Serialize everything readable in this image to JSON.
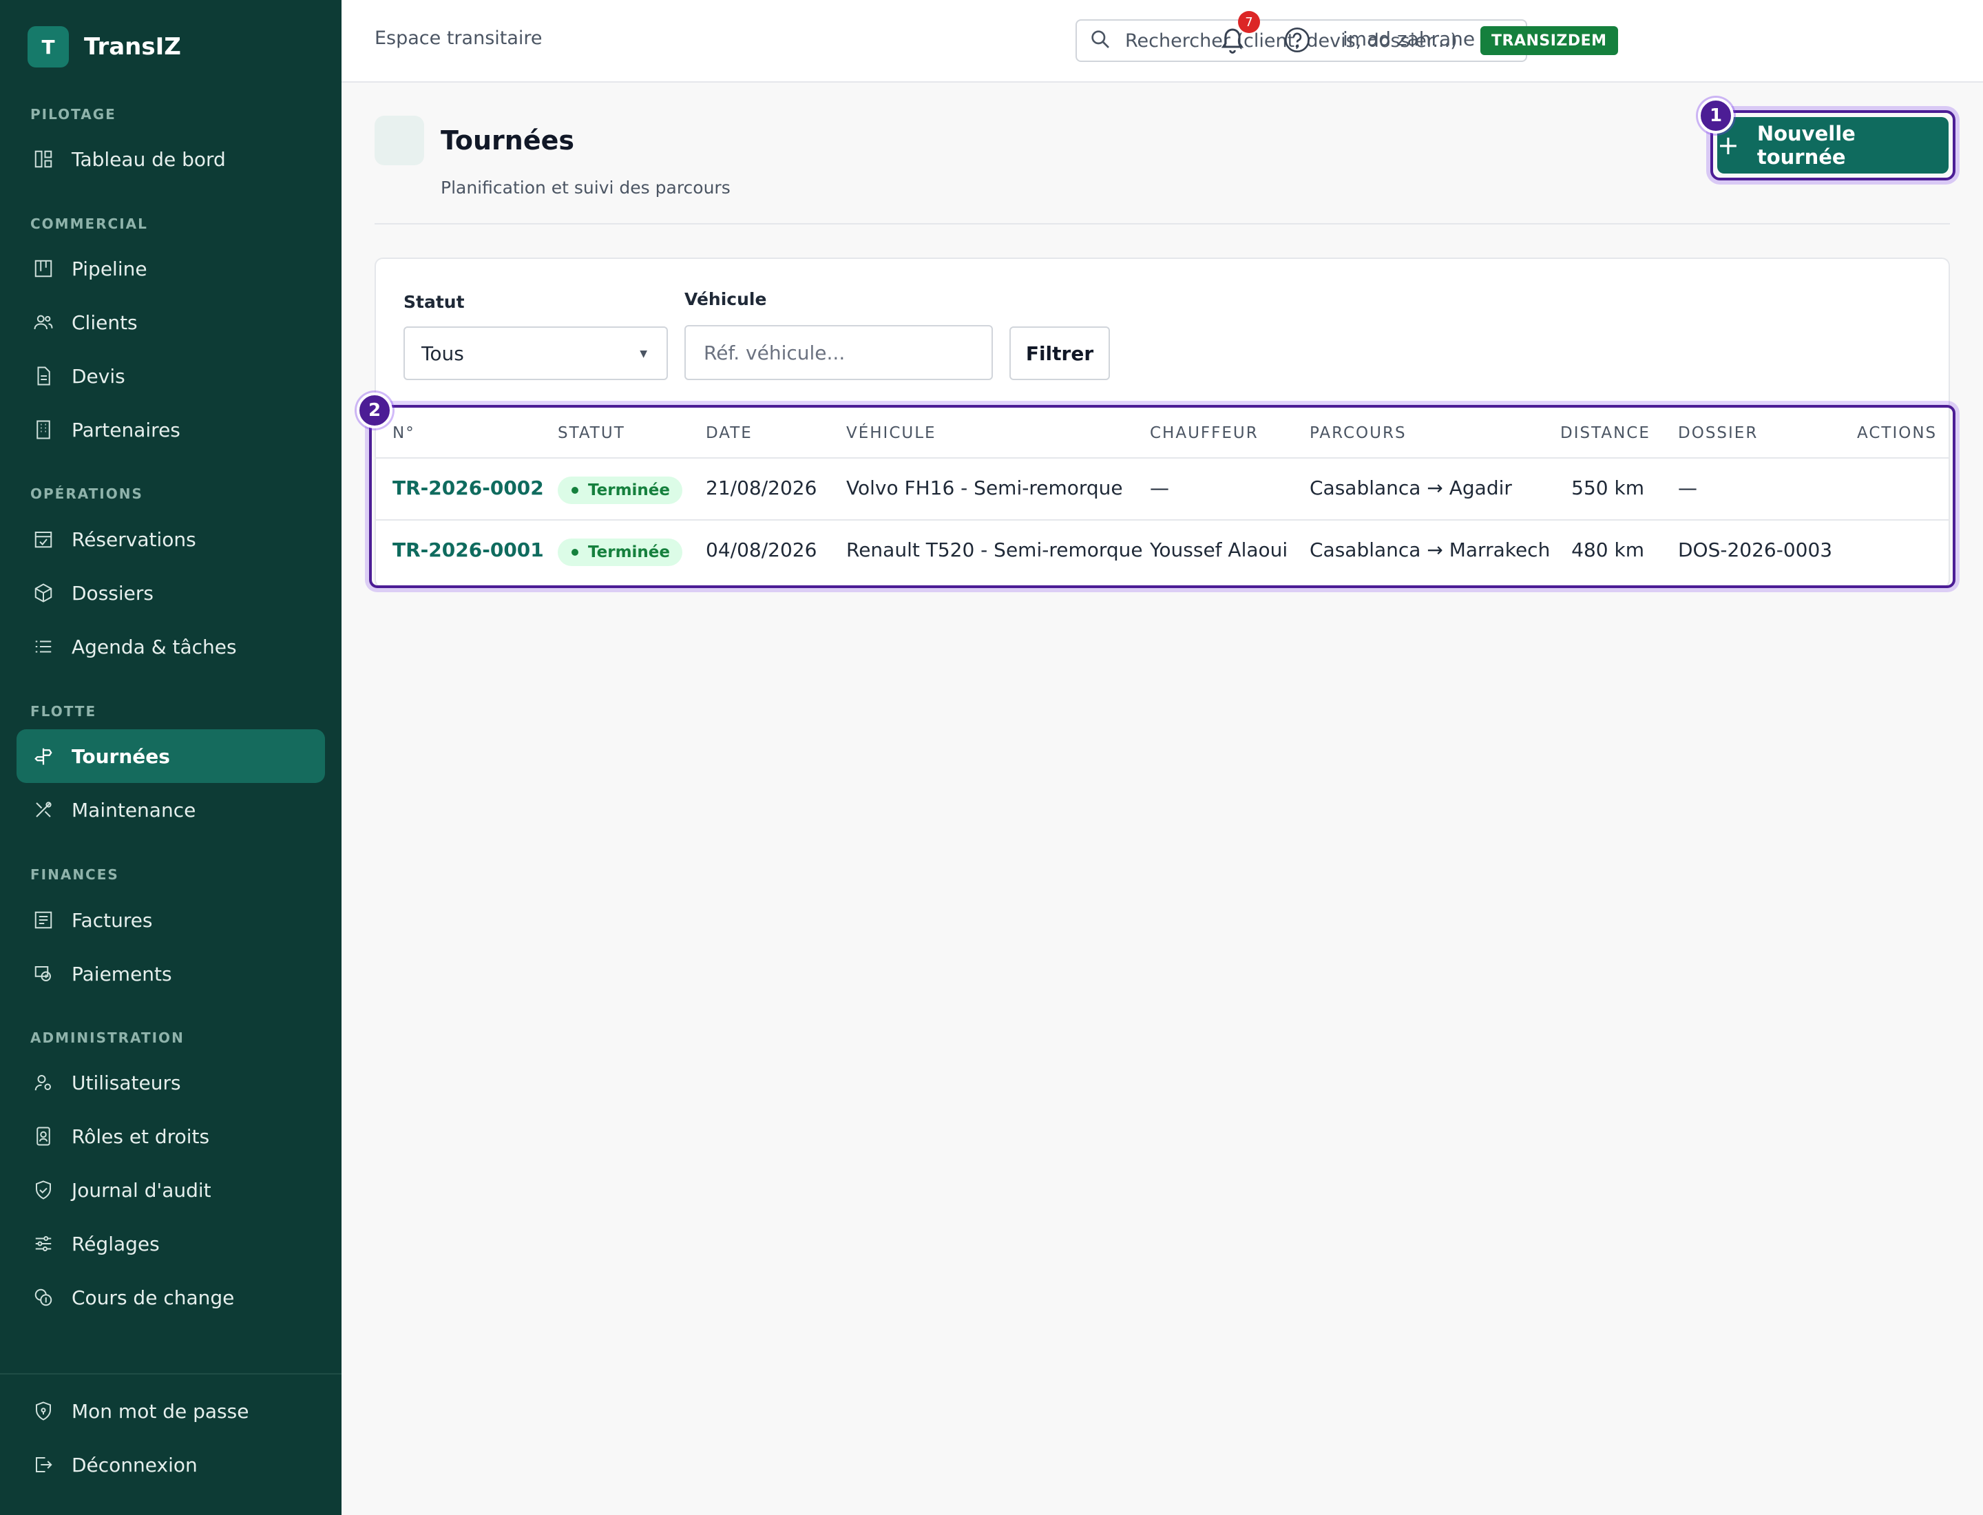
{
  "app": {
    "name": "TransIZ",
    "logo_letter": "T"
  },
  "sidebar": {
    "sections": [
      {
        "title": "PILOTAGE",
        "items": [
          {
            "label": "Tableau de bord",
            "icon": "dashboard-icon"
          }
        ]
      },
      {
        "title": "COMMERCIAL",
        "items": [
          {
            "label": "Pipeline",
            "icon": "kanban-icon"
          },
          {
            "label": "Clients",
            "icon": "users-icon"
          },
          {
            "label": "Devis",
            "icon": "document-icon"
          },
          {
            "label": "Partenaires",
            "icon": "building-icon"
          }
        ]
      },
      {
        "title": "OPÉRATIONS",
        "items": [
          {
            "label": "Réservations",
            "icon": "calendar-check-icon"
          },
          {
            "label": "Dossiers",
            "icon": "box-icon"
          },
          {
            "label": "Agenda & tâches",
            "icon": "list-icon"
          }
        ]
      },
      {
        "title": "FLOTTE",
        "items": [
          {
            "label": "Tournées",
            "icon": "signpost-icon",
            "active": true
          },
          {
            "label": "Maintenance",
            "icon": "tools-icon"
          }
        ]
      },
      {
        "title": "FINANCES",
        "items": [
          {
            "label": "Factures",
            "icon": "invoice-icon"
          },
          {
            "label": "Paiements",
            "icon": "payment-icon"
          }
        ]
      },
      {
        "title": "ADMINISTRATION",
        "items": [
          {
            "label": "Utilisateurs",
            "icon": "user-gear-icon"
          },
          {
            "label": "Rôles et droits",
            "icon": "badge-icon"
          },
          {
            "label": "Journal d'audit",
            "icon": "shield-icon"
          },
          {
            "label": "Réglages",
            "icon": "sliders-icon"
          },
          {
            "label": "Cours de change",
            "icon": "coins-icon"
          }
        ]
      }
    ],
    "footer": [
      {
        "label": "Mon mot de passe",
        "icon": "shield-lock-icon"
      },
      {
        "label": "Déconnexion",
        "icon": "logout-icon"
      }
    ]
  },
  "topbar": {
    "title": "Espace transitaire",
    "search_placeholder": "Rechercher (client, devis, dossier...)",
    "notifications_count": "7",
    "username": "imad zahrane",
    "tenant": "TRANSIZDEM"
  },
  "page": {
    "title": "Tournées",
    "subtitle": "Planification et suivi des parcours",
    "new_button": "Nouvelle tournée",
    "new_button_icon": "plus-icon"
  },
  "markers": [
    "1",
    "2"
  ],
  "filters": {
    "status_label": "Statut",
    "status_value": "Tous",
    "vehicle_label": "Véhicule",
    "vehicle_placeholder": "Réf. véhicule...",
    "filter_button": "Filtrer"
  },
  "table": {
    "columns": [
      "N°",
      "STATUT",
      "DATE",
      "VÉHICULE",
      "CHAUFFEUR",
      "PARCOURS",
      "DISTANCE",
      "DOSSIER",
      "ACTIONS"
    ],
    "rows": [
      {
        "number": "TR-2026-0002",
        "status": "Terminée",
        "date": "21/08/2026",
        "vehicle": "Volvo FH16 - Semi-remorque",
        "driver": "—",
        "route": "Casablanca → Agadir",
        "distance": "550 km",
        "dossier": "—"
      },
      {
        "number": "TR-2026-0001",
        "status": "Terminée",
        "date": "04/08/2026",
        "vehicle": "Renault T520 - Semi-remorque",
        "driver": "Youssef Alaoui",
        "route": "Casablanca → Marrakech",
        "distance": "480 km",
        "dossier": "DOS-2026-0003"
      }
    ]
  },
  "colors": {
    "sidebar_bg": "#0d3b35",
    "accent": "#0f6b5e",
    "active_nav": "#156b5d",
    "highlight": "#4c1d95",
    "badge_bg": "#dcfce7",
    "badge_fg": "#15803d",
    "notif": "#dc2626"
  }
}
